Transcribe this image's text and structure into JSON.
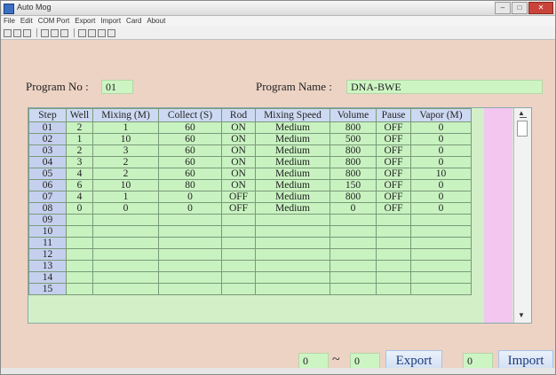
{
  "window": {
    "title": "Auto Mog"
  },
  "menu": [
    "File",
    "Edit",
    "COM Port",
    "Export",
    "Import",
    "Card",
    "About"
  ],
  "program": {
    "no_label": "Program No :",
    "no_value": "01",
    "name_label": "Program Name :",
    "name_value": "DNA-BWE"
  },
  "table": {
    "columns": [
      "Step",
      "Well",
      "Mixing (M)",
      "Collect (S)",
      "Rod",
      "Mixing Speed",
      "Volume",
      "Pause",
      "Vapor (M)"
    ],
    "rows": [
      [
        "01",
        "2",
        "1",
        "60",
        "ON",
        "Medium",
        "800",
        "OFF",
        "0"
      ],
      [
        "02",
        "1",
        "10",
        "60",
        "ON",
        "Medium",
        "500",
        "OFF",
        "0"
      ],
      [
        "03",
        "2",
        "3",
        "60",
        "ON",
        "Medium",
        "800",
        "OFF",
        "0"
      ],
      [
        "04",
        "3",
        "2",
        "60",
        "ON",
        "Medium",
        "800",
        "OFF",
        "0"
      ],
      [
        "05",
        "4",
        "2",
        "60",
        "ON",
        "Medium",
        "800",
        "OFF",
        "10"
      ],
      [
        "06",
        "6",
        "10",
        "80",
        "ON",
        "Medium",
        "150",
        "OFF",
        "0"
      ],
      [
        "07",
        "4",
        "1",
        "0",
        "OFF",
        "Medium",
        "800",
        "OFF",
        "0"
      ],
      [
        "08",
        "0",
        "0",
        "0",
        "OFF",
        "Medium",
        "0",
        "OFF",
        "0"
      ],
      [
        "09",
        "",
        "",
        "",
        "",
        "",
        "",
        "",
        ""
      ],
      [
        "10",
        "",
        "",
        "",
        "",
        "",
        "",
        "",
        ""
      ],
      [
        "11",
        "",
        "",
        "",
        "",
        "",
        "",
        "",
        ""
      ],
      [
        "12",
        "",
        "",
        "",
        "",
        "",
        "",
        "",
        ""
      ],
      [
        "13",
        "",
        "",
        "",
        "",
        "",
        "",
        "",
        ""
      ],
      [
        "14",
        "",
        "",
        "",
        "",
        "",
        "",
        "",
        ""
      ],
      [
        "15",
        "",
        "",
        "",
        "",
        "",
        "",
        "",
        ""
      ]
    ]
  },
  "export": {
    "from": "0",
    "tilde": "~",
    "to": "0",
    "button": "Export"
  },
  "import": {
    "slot": "0",
    "button": "Import"
  }
}
